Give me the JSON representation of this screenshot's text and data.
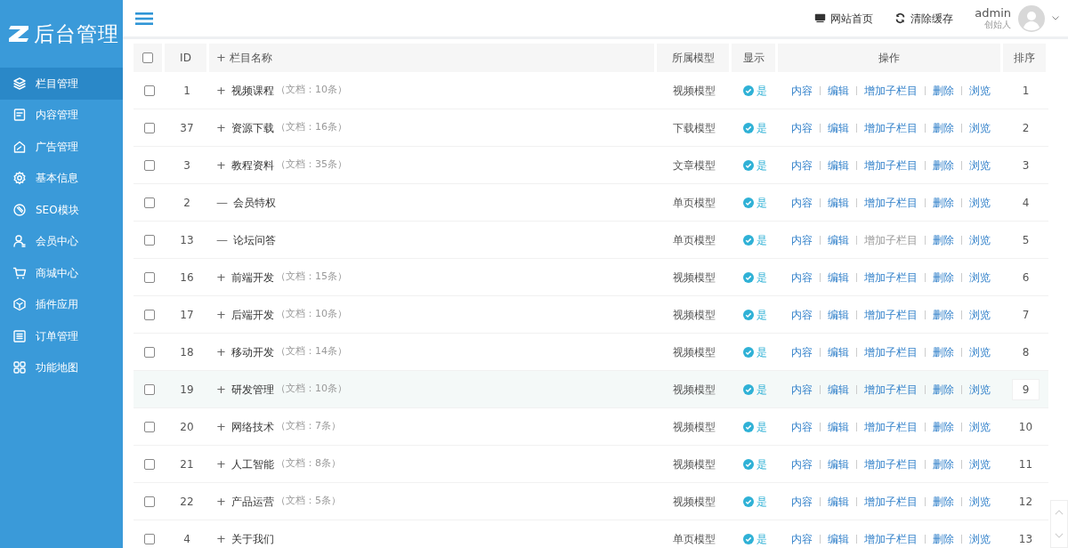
{
  "sidebar": {
    "logo": "后台管理",
    "items": [
      {
        "label": "栏目管理",
        "selected": true
      },
      {
        "label": "内容管理",
        "selected": false
      },
      {
        "label": "广告管理",
        "selected": false
      },
      {
        "label": "基本信息",
        "selected": false
      },
      {
        "label": "SEO模块",
        "selected": false
      },
      {
        "label": "会员中心",
        "selected": false
      },
      {
        "label": "商城中心",
        "selected": false
      },
      {
        "label": "插件应用",
        "selected": false
      },
      {
        "label": "订单管理",
        "selected": false
      },
      {
        "label": "功能地图",
        "selected": false
      }
    ]
  },
  "header": {
    "links": [
      {
        "label": "网站首页",
        "kind": "monitor"
      },
      {
        "label": "清除缓存",
        "kind": "refresh"
      }
    ],
    "user": {
      "name": "admin",
      "role": "创始人"
    }
  },
  "table": {
    "header_checked": false,
    "columns": [
      "ID",
      "栏目名称",
      "所属模型",
      "显示",
      "操作",
      "排序"
    ],
    "name_toggle": "+",
    "rows": [
      {
        "checked": false,
        "selected": false,
        "id": "1",
        "toggle": "+",
        "name": "视频课程",
        "count": "（文档：10条）",
        "model": "视频模型",
        "display": "是",
        "actions": [
          {
            "label": "内容",
            "disabled": false
          },
          {
            "label": "编辑",
            "disabled": false
          },
          {
            "label": "增加子栏目",
            "disabled": false
          },
          {
            "label": "删除",
            "disabled": false
          },
          {
            "label": "浏览",
            "disabled": false
          }
        ],
        "sort": "1"
      },
      {
        "checked": false,
        "selected": false,
        "id": "37",
        "toggle": "+",
        "name": "资源下载",
        "count": "（文档：16条）",
        "model": "下载模型",
        "display": "是",
        "actions": [
          {
            "label": "内容",
            "disabled": false
          },
          {
            "label": "编辑",
            "disabled": false
          },
          {
            "label": "增加子栏目",
            "disabled": false
          },
          {
            "label": "删除",
            "disabled": false
          },
          {
            "label": "浏览",
            "disabled": false
          }
        ],
        "sort": "2"
      },
      {
        "checked": false,
        "selected": false,
        "id": "3",
        "toggle": "+",
        "name": "教程资料",
        "count": "（文档：35条）",
        "model": "文章模型",
        "display": "是",
        "actions": [
          {
            "label": "内容",
            "disabled": false
          },
          {
            "label": "编辑",
            "disabled": false
          },
          {
            "label": "增加子栏目",
            "disabled": false
          },
          {
            "label": "删除",
            "disabled": false
          },
          {
            "label": "浏览",
            "disabled": false
          }
        ],
        "sort": "3"
      },
      {
        "checked": false,
        "selected": false,
        "id": "2",
        "toggle": "—",
        "name": "会员特权",
        "model": "单页模型",
        "display": "是",
        "actions": [
          {
            "label": "内容",
            "disabled": false
          },
          {
            "label": "编辑",
            "disabled": false
          },
          {
            "label": "增加子栏目",
            "disabled": false
          },
          {
            "label": "删除",
            "disabled": false
          },
          {
            "label": "浏览",
            "disabled": false
          }
        ],
        "sort": "4"
      },
      {
        "checked": false,
        "selected": false,
        "id": "13",
        "toggle": "—",
        "name": "论坛问答",
        "model": "单页模型",
        "display": "是",
        "actions": [
          {
            "label": "内容",
            "disabled": false
          },
          {
            "label": "编辑",
            "disabled": false
          },
          {
            "label": "增加子栏目",
            "disabled": true
          },
          {
            "label": "删除",
            "disabled": false
          },
          {
            "label": "浏览",
            "disabled": false
          }
        ],
        "sort": "5"
      },
      {
        "checked": false,
        "selected": false,
        "id": "16",
        "toggle": "+",
        "name": "前端开发",
        "count": "（文档：15条）",
        "model": "视频模型",
        "display": "是",
        "actions": [
          {
            "label": "内容",
            "disabled": false
          },
          {
            "label": "编辑",
            "disabled": false
          },
          {
            "label": "增加子栏目",
            "disabled": false
          },
          {
            "label": "删除",
            "disabled": false
          },
          {
            "label": "浏览",
            "disabled": false
          }
        ],
        "sort": "6"
      },
      {
        "checked": false,
        "selected": false,
        "id": "17",
        "toggle": "+",
        "name": "后端开发",
        "count": "（文档：10条）",
        "model": "视频模型",
        "display": "是",
        "actions": [
          {
            "label": "内容",
            "disabled": false
          },
          {
            "label": "编辑",
            "disabled": false
          },
          {
            "label": "增加子栏目",
            "disabled": false
          },
          {
            "label": "删除",
            "disabled": false
          },
          {
            "label": "浏览",
            "disabled": false
          }
        ],
        "sort": "7"
      },
      {
        "checked": false,
        "selected": false,
        "id": "18",
        "toggle": "+",
        "name": "移动开发",
        "count": "（文档：14条）",
        "model": "视频模型",
        "display": "是",
        "actions": [
          {
            "label": "内容",
            "disabled": false
          },
          {
            "label": "编辑",
            "disabled": false
          },
          {
            "label": "增加子栏目",
            "disabled": false
          },
          {
            "label": "删除",
            "disabled": false
          },
          {
            "label": "浏览",
            "disabled": false
          }
        ],
        "sort": "8"
      },
      {
        "checked": false,
        "selected": true,
        "id": "19",
        "toggle": "+",
        "name": "研发管理",
        "count": "（文档：10条）",
        "model": "视频模型",
        "display": "是",
        "actions": [
          {
            "label": "内容",
            "disabled": false
          },
          {
            "label": "编辑",
            "disabled": false
          },
          {
            "label": "增加子栏目",
            "disabled": false
          },
          {
            "label": "删除",
            "disabled": false
          },
          {
            "label": "浏览",
            "disabled": false
          }
        ],
        "sort": "9"
      },
      {
        "checked": false,
        "selected": false,
        "id": "20",
        "toggle": "+",
        "name": "网络技术",
        "count": "（文档：7条）",
        "model": "视频模型",
        "display": "是",
        "actions": [
          {
            "label": "内容",
            "disabled": false
          },
          {
            "label": "编辑",
            "disabled": false
          },
          {
            "label": "增加子栏目",
            "disabled": false
          },
          {
            "label": "删除",
            "disabled": false
          },
          {
            "label": "浏览",
            "disabled": false
          }
        ],
        "sort": "10"
      },
      {
        "checked": false,
        "selected": false,
        "id": "21",
        "toggle": "+",
        "name": "人工智能",
        "count": "（文档：8条）",
        "model": "视频模型",
        "display": "是",
        "actions": [
          {
            "label": "内容",
            "disabled": false
          },
          {
            "label": "编辑",
            "disabled": false
          },
          {
            "label": "增加子栏目",
            "disabled": false
          },
          {
            "label": "删除",
            "disabled": false
          },
          {
            "label": "浏览",
            "disabled": false
          }
        ],
        "sort": "11"
      },
      {
        "checked": false,
        "selected": false,
        "id": "22",
        "toggle": "+",
        "name": "产品运营",
        "count": "（文档：5条）",
        "model": "视频模型",
        "display": "是",
        "actions": [
          {
            "label": "内容",
            "disabled": false
          },
          {
            "label": "编辑",
            "disabled": false
          },
          {
            "label": "增加子栏目",
            "disabled": false
          },
          {
            "label": "删除",
            "disabled": false
          },
          {
            "label": "浏览",
            "disabled": false
          }
        ],
        "sort": "12"
      },
      {
        "checked": false,
        "selected": false,
        "id": "4",
        "toggle": "+",
        "name": "关于我们",
        "model": "单页模型",
        "display": "是",
        "actions": [
          {
            "label": "内容",
            "disabled": false
          },
          {
            "label": "编辑",
            "disabled": false
          },
          {
            "label": "增加子栏目",
            "disabled": false
          },
          {
            "label": "删除",
            "disabled": false
          },
          {
            "label": "浏览",
            "disabled": false
          }
        ],
        "sort": "13"
      }
    ]
  }
}
